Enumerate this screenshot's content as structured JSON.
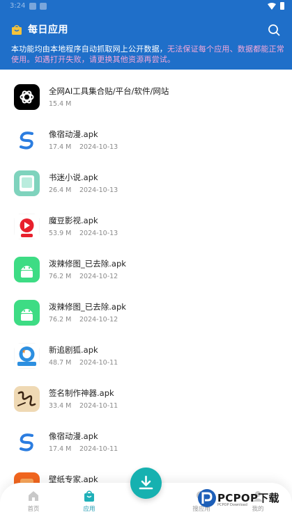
{
  "status_bar": {
    "time": "3:24"
  },
  "header": {
    "title": "每日应用",
    "notice_main": "本功能均由本地程序自动抓取网上公开数据，",
    "notice_warn_1": "无法保证每个应用、数据都能正常",
    "notice_warn_2": "使用。如遇打开失败，请更换其他资源再尝试。",
    "accent_color": "#1f6fc9",
    "warn_color": "#f3a8d9"
  },
  "apps": [
    {
      "name": "全网AI工具集合贴/平台/软件/网站",
      "size": "15.4 M",
      "date": "",
      "icon": "openai-icon"
    },
    {
      "name": "像宿动漫.apk",
      "size": "17.4 M",
      "date": "2024-10-13",
      "icon": "s-logo-icon"
    },
    {
      "name": "书迷小说.apk",
      "size": "26.4 M",
      "date": "2024-10-13",
      "icon": "book-icon"
    },
    {
      "name": "魔豆影视.apk",
      "size": "53.9 M",
      "date": "2024-10-13",
      "icon": "play-icon"
    },
    {
      "name": "泼辣修图_已去除.apk",
      "size": "76.2 M",
      "date": "2024-10-12",
      "icon": "android-icon"
    },
    {
      "name": "泼辣修图_已去除.apk",
      "size": "76.2 M",
      "date": "2024-10-12",
      "icon": "android-icon"
    },
    {
      "name": "新追剧狐.apk",
      "size": "48.7 M",
      "date": "2024-10-11",
      "icon": "fox-icon"
    },
    {
      "name": "签名制作神器.apk",
      "size": "33.4 M",
      "date": "2024-10-11",
      "icon": "signature-icon"
    },
    {
      "name": "像宿动漫.apk",
      "size": "17.4 M",
      "date": "2024-10-11",
      "icon": "s-logo-icon"
    },
    {
      "name": "壁纸专家.apk",
      "size": "",
      "date": "",
      "icon": "wallpaper-icon"
    }
  ],
  "nav": [
    {
      "label": "首页",
      "icon": "home-icon",
      "active": false
    },
    {
      "label": "应用",
      "icon": "bag-icon",
      "active": true
    },
    {
      "label": "搜应用",
      "icon": "search-app-icon",
      "active": false
    },
    {
      "label": "我的",
      "icon": "user-icon",
      "active": false
    }
  ],
  "watermark": {
    "text": "PCPOP下载",
    "sub": "PCPOP Download"
  }
}
